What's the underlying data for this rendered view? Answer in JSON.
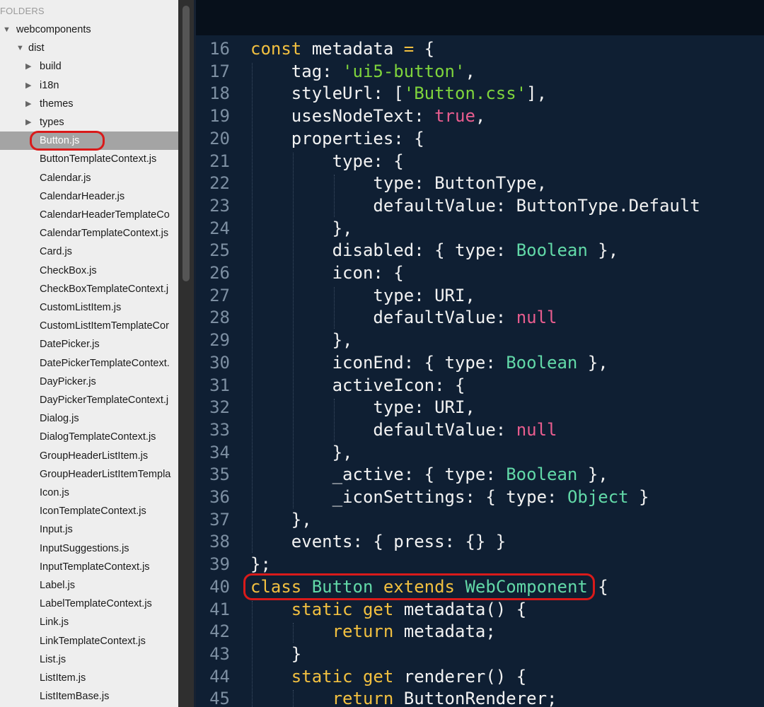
{
  "sidebar": {
    "header": "FOLDERS",
    "tree": [
      {
        "label": "webcomponents",
        "depth": 0,
        "arrow": "▼"
      },
      {
        "label": "dist",
        "depth": 1,
        "arrow": "▼"
      },
      {
        "label": "build",
        "depth": 2,
        "arrow": "▶"
      },
      {
        "label": "i18n",
        "depth": 2,
        "arrow": "▶"
      },
      {
        "label": "themes",
        "depth": 2,
        "arrow": "▶"
      },
      {
        "label": "types",
        "depth": 2,
        "arrow": "▶"
      },
      {
        "label": "Button.js",
        "depth": 2,
        "selected": true,
        "highlighted": true
      },
      {
        "label": "ButtonTemplateContext.js",
        "depth": 2
      },
      {
        "label": "Calendar.js",
        "depth": 2
      },
      {
        "label": "CalendarHeader.js",
        "depth": 2
      },
      {
        "label": "CalendarHeaderTemplateCo",
        "depth": 2
      },
      {
        "label": "CalendarTemplateContext.js",
        "depth": 2
      },
      {
        "label": "Card.js",
        "depth": 2
      },
      {
        "label": "CheckBox.js",
        "depth": 2
      },
      {
        "label": "CheckBoxTemplateContext.j",
        "depth": 2
      },
      {
        "label": "CustomListItem.js",
        "depth": 2
      },
      {
        "label": "CustomListItemTemplateCor",
        "depth": 2
      },
      {
        "label": "DatePicker.js",
        "depth": 2
      },
      {
        "label": "DatePickerTemplateContext.",
        "depth": 2
      },
      {
        "label": "DayPicker.js",
        "depth": 2
      },
      {
        "label": "DayPickerTemplateContext.j",
        "depth": 2
      },
      {
        "label": "Dialog.js",
        "depth": 2
      },
      {
        "label": "DialogTemplateContext.js",
        "depth": 2
      },
      {
        "label": "GroupHeaderListItem.js",
        "depth": 2
      },
      {
        "label": "GroupHeaderListItemTempla",
        "depth": 2
      },
      {
        "label": "Icon.js",
        "depth": 2
      },
      {
        "label": "IconTemplateContext.js",
        "depth": 2
      },
      {
        "label": "Input.js",
        "depth": 2
      },
      {
        "label": "InputSuggestions.js",
        "depth": 2
      },
      {
        "label": "InputTemplateContext.js",
        "depth": 2
      },
      {
        "label": "Label.js",
        "depth": 2
      },
      {
        "label": "LabelTemplateContext.js",
        "depth": 2
      },
      {
        "label": "Link.js",
        "depth": 2
      },
      {
        "label": "LinkTemplateContext.js",
        "depth": 2
      },
      {
        "label": "List.js",
        "depth": 2
      },
      {
        "label": "ListItem.js",
        "depth": 2
      },
      {
        "label": "ListItemBase.js",
        "depth": 2
      }
    ]
  },
  "editor": {
    "highlight_color": "#d91a1a",
    "colors": {
      "keyword": "#f2c040",
      "string": "#7fd43c",
      "literal": "#e95d8f",
      "type": "#62d9a8",
      "plain": "#f2f2f2",
      "line_number": "#7d8fa2"
    },
    "lines": [
      {
        "n": "16",
        "indent": 0,
        "tokens": [
          [
            "k",
            "const"
          ],
          [
            "p",
            " metadata "
          ],
          [
            "k",
            "="
          ],
          [
            "p",
            " {"
          ]
        ]
      },
      {
        "n": "17",
        "indent": 1,
        "tokens": [
          [
            "p",
            "tag: "
          ],
          [
            "s",
            "'ui5-button'"
          ],
          [
            "p",
            ","
          ]
        ]
      },
      {
        "n": "18",
        "indent": 1,
        "tokens": [
          [
            "p",
            "styleUrl: ["
          ],
          [
            "s",
            "'Button.css'"
          ],
          [
            "p",
            "],"
          ]
        ]
      },
      {
        "n": "19",
        "indent": 1,
        "tokens": [
          [
            "p",
            "usesNodeText: "
          ],
          [
            "r",
            "true"
          ],
          [
            "p",
            ","
          ]
        ]
      },
      {
        "n": "20",
        "indent": 1,
        "tokens": [
          [
            "p",
            "properties: {"
          ]
        ]
      },
      {
        "n": "21",
        "indent": 2,
        "tokens": [
          [
            "p",
            "type: {"
          ]
        ]
      },
      {
        "n": "22",
        "indent": 3,
        "tokens": [
          [
            "p",
            "type: ButtonType,"
          ]
        ]
      },
      {
        "n": "23",
        "indent": 3,
        "tokens": [
          [
            "p",
            "defaultValue: ButtonType.Default"
          ]
        ]
      },
      {
        "n": "24",
        "indent": 2,
        "tokens": [
          [
            "p",
            "},"
          ]
        ]
      },
      {
        "n": "25",
        "indent": 2,
        "tokens": [
          [
            "p",
            "disabled: { type: "
          ],
          [
            "t",
            "Boolean"
          ],
          [
            "p",
            " },"
          ]
        ]
      },
      {
        "n": "26",
        "indent": 2,
        "tokens": [
          [
            "p",
            "icon: {"
          ]
        ]
      },
      {
        "n": "27",
        "indent": 3,
        "tokens": [
          [
            "p",
            "type: URI,"
          ]
        ]
      },
      {
        "n": "28",
        "indent": 3,
        "tokens": [
          [
            "p",
            "defaultValue: "
          ],
          [
            "r",
            "null"
          ]
        ]
      },
      {
        "n": "29",
        "indent": 2,
        "tokens": [
          [
            "p",
            "},"
          ]
        ]
      },
      {
        "n": "30",
        "indent": 2,
        "tokens": [
          [
            "p",
            "iconEnd: { type: "
          ],
          [
            "t",
            "Boolean"
          ],
          [
            "p",
            " },"
          ]
        ]
      },
      {
        "n": "31",
        "indent": 2,
        "tokens": [
          [
            "p",
            "activeIcon: {"
          ]
        ]
      },
      {
        "n": "32",
        "indent": 3,
        "tokens": [
          [
            "p",
            "type: URI,"
          ]
        ]
      },
      {
        "n": "33",
        "indent": 3,
        "tokens": [
          [
            "p",
            "defaultValue: "
          ],
          [
            "r",
            "null"
          ]
        ]
      },
      {
        "n": "34",
        "indent": 2,
        "tokens": [
          [
            "p",
            "},"
          ]
        ]
      },
      {
        "n": "35",
        "indent": 2,
        "tokens": [
          [
            "p",
            "_active: { type: "
          ],
          [
            "t",
            "Boolean"
          ],
          [
            "p",
            " },"
          ]
        ]
      },
      {
        "n": "36",
        "indent": 2,
        "tokens": [
          [
            "p",
            "_iconSettings: { type: "
          ],
          [
            "t",
            "Object"
          ],
          [
            "p",
            " }"
          ]
        ]
      },
      {
        "n": "37",
        "indent": 1,
        "tokens": [
          [
            "p",
            "},"
          ]
        ]
      },
      {
        "n": "38",
        "indent": 1,
        "tokens": [
          [
            "p",
            "events: { press: {} }"
          ]
        ]
      },
      {
        "n": "39",
        "indent": 0,
        "tokens": [
          [
            "p",
            "};"
          ]
        ]
      },
      {
        "n": "40",
        "indent": 0,
        "highlighted": true,
        "tokens": [
          [
            "k",
            "class"
          ],
          [
            "p",
            " "
          ],
          [
            "t",
            "Button"
          ],
          [
            "p",
            " "
          ],
          [
            "k",
            "extends"
          ],
          [
            "p",
            " "
          ],
          [
            "t",
            "WebComponent"
          ],
          [
            "p",
            " {"
          ]
        ]
      },
      {
        "n": "41",
        "indent": 1,
        "tokens": [
          [
            "k",
            "static"
          ],
          [
            "p",
            " "
          ],
          [
            "k",
            "get"
          ],
          [
            "p",
            " metadata() {"
          ]
        ]
      },
      {
        "n": "42",
        "indent": 2,
        "tokens": [
          [
            "k",
            "return"
          ],
          [
            "p",
            " metadata;"
          ]
        ]
      },
      {
        "n": "43",
        "indent": 1,
        "tokens": [
          [
            "p",
            "}"
          ]
        ]
      },
      {
        "n": "44",
        "indent": 1,
        "tokens": [
          [
            "k",
            "static"
          ],
          [
            "p",
            " "
          ],
          [
            "k",
            "get"
          ],
          [
            "p",
            " renderer() {"
          ]
        ]
      },
      {
        "n": "45",
        "indent": 2,
        "tokens": [
          [
            "k",
            "return"
          ],
          [
            "p",
            " ButtonRenderer;"
          ]
        ]
      }
    ]
  }
}
